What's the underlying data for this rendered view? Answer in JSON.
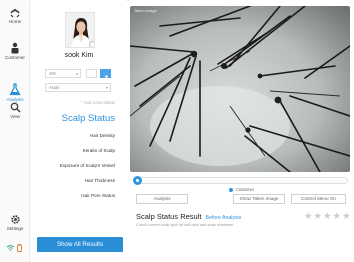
{
  "nav": {
    "items": [
      {
        "label": "Home",
        "icon": "home-icon"
      },
      {
        "label": "Customer",
        "icon": "customer-icon"
      },
      {
        "label": "Analysis",
        "icon": "flask-icon",
        "active": true
      },
      {
        "label": "View",
        "icon": "magnifier-icon"
      }
    ],
    "settings_label": "Settings",
    "status_icons": [
      "wifi-icon",
      "battery-icon"
    ]
  },
  "profile": {
    "name": "sook Kim",
    "selects": [
      {
        "value": "40s"
      },
      {
        "value": "Asian"
      }
    ]
  },
  "menu": {
    "hint": "Hair Loss Status",
    "title": "Scalp Status",
    "items": [
      "Hair Density",
      "Keratin of Scalp",
      "Exposure of Scalp's Vessel",
      "Hair Thickness",
      "Hair Pore Status"
    ],
    "cta": "Show All Results"
  },
  "scope": {
    "tag": "Taken image"
  },
  "controls": {
    "progress": 0.0,
    "legend": "Customer",
    "analysis": "Analysis",
    "show_taken": "Show Taken Image",
    "control_menu": "Control Menu On"
  },
  "result": {
    "title": "Scalp Status Result",
    "link": "Before Analysis",
    "sub": "Check current scalp type for self-care and scalp treatment",
    "rating": 0,
    "stars": "★★★★★"
  },
  "colors": {
    "accent": "#2f93de",
    "cta": "#2a8fd7"
  }
}
